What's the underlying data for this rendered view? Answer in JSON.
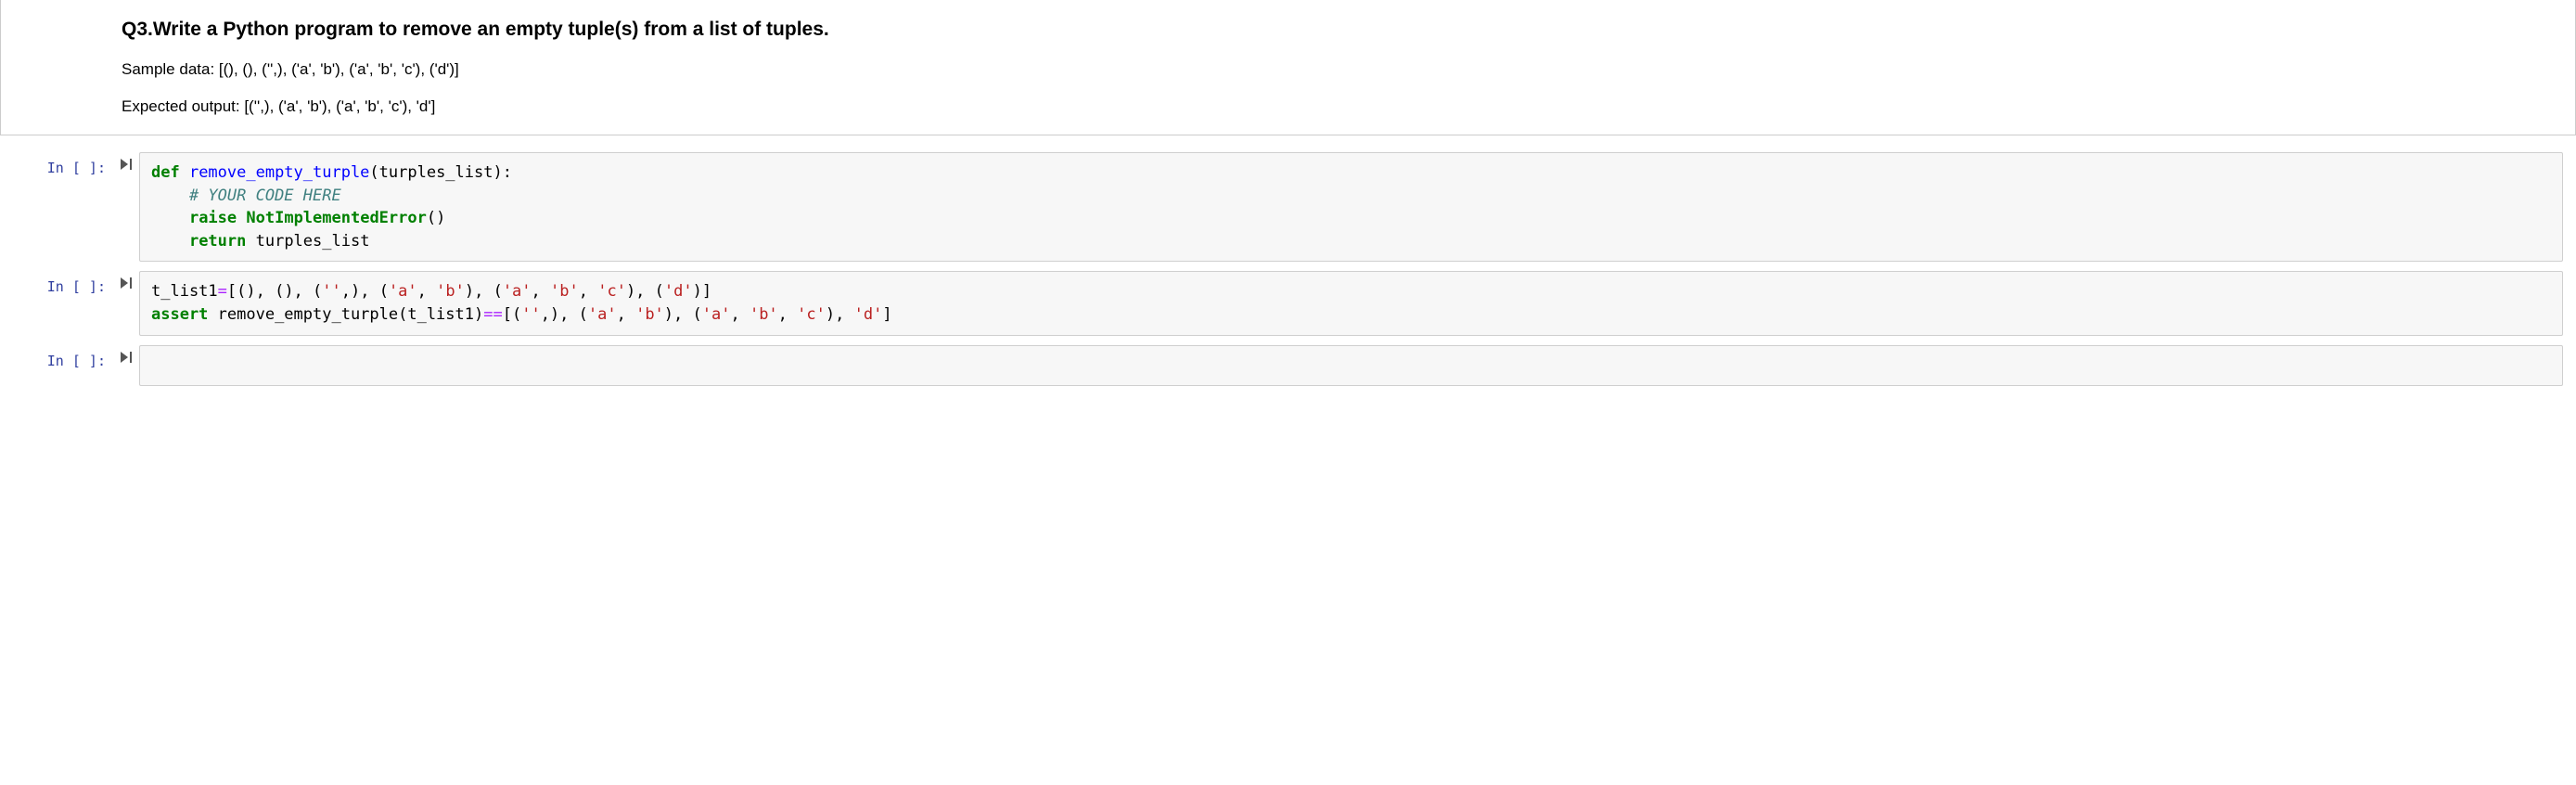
{
  "markdown": {
    "heading": "Q3.Write a Python program to remove an empty tuple(s) from a list of tuples.",
    "sample": "Sample data: [(), (), ('',), ('a', 'b'), ('a', 'b', 'c'), ('d')]",
    "expected": "Expected output: [('',), ('a', 'b'), ('a', 'b', 'c'), 'd']"
  },
  "cells": [
    {
      "prompt": "In [ ]:",
      "code_tokens": [
        {
          "t": "def ",
          "c": "tok-kw"
        },
        {
          "t": "remove_empty_turple",
          "c": "tok-def"
        },
        {
          "t": "(turples_list):",
          "c": ""
        },
        {
          "t": "\n",
          "c": ""
        },
        {
          "t": "    ",
          "c": ""
        },
        {
          "t": "# YOUR CODE HERE",
          "c": "tok-comm"
        },
        {
          "t": "\n",
          "c": ""
        },
        {
          "t": "    ",
          "c": ""
        },
        {
          "t": "raise",
          "c": "tok-kw"
        },
        {
          "t": " ",
          "c": ""
        },
        {
          "t": "NotImplementedError",
          "c": "tok-err"
        },
        {
          "t": "()",
          "c": ""
        },
        {
          "t": "\n",
          "c": ""
        },
        {
          "t": "    ",
          "c": ""
        },
        {
          "t": "return",
          "c": "tok-kw"
        },
        {
          "t": " turples_list",
          "c": ""
        }
      ]
    },
    {
      "prompt": "In [ ]:",
      "code_tokens": [
        {
          "t": "t_list1",
          "c": ""
        },
        {
          "t": "=",
          "c": "tok-op"
        },
        {
          "t": "[(), (), (",
          "c": ""
        },
        {
          "t": "''",
          "c": "tok-str"
        },
        {
          "t": ",), (",
          "c": ""
        },
        {
          "t": "'a'",
          "c": "tok-str"
        },
        {
          "t": ", ",
          "c": ""
        },
        {
          "t": "'b'",
          "c": "tok-str"
        },
        {
          "t": "), (",
          "c": ""
        },
        {
          "t": "'a'",
          "c": "tok-str"
        },
        {
          "t": ", ",
          "c": ""
        },
        {
          "t": "'b'",
          "c": "tok-str"
        },
        {
          "t": ", ",
          "c": ""
        },
        {
          "t": "'c'",
          "c": "tok-str"
        },
        {
          "t": "), (",
          "c": ""
        },
        {
          "t": "'d'",
          "c": "tok-str"
        },
        {
          "t": ")]",
          "c": ""
        },
        {
          "t": "\n",
          "c": ""
        },
        {
          "t": "assert",
          "c": "tok-kw"
        },
        {
          "t": " remove_empty_turple(t_list1)",
          "c": ""
        },
        {
          "t": "==",
          "c": "tok-op"
        },
        {
          "t": "[(",
          "c": ""
        },
        {
          "t": "''",
          "c": "tok-str"
        },
        {
          "t": ",), (",
          "c": ""
        },
        {
          "t": "'a'",
          "c": "tok-str"
        },
        {
          "t": ", ",
          "c": ""
        },
        {
          "t": "'b'",
          "c": "tok-str"
        },
        {
          "t": "), (",
          "c": ""
        },
        {
          "t": "'a'",
          "c": "tok-str"
        },
        {
          "t": ", ",
          "c": ""
        },
        {
          "t": "'b'",
          "c": "tok-str"
        },
        {
          "t": ", ",
          "c": ""
        },
        {
          "t": "'c'",
          "c": "tok-str"
        },
        {
          "t": "), ",
          "c": ""
        },
        {
          "t": "'d'",
          "c": "tok-str"
        },
        {
          "t": "]",
          "c": ""
        }
      ]
    },
    {
      "prompt": "In [ ]:",
      "code_tokens": []
    }
  ]
}
